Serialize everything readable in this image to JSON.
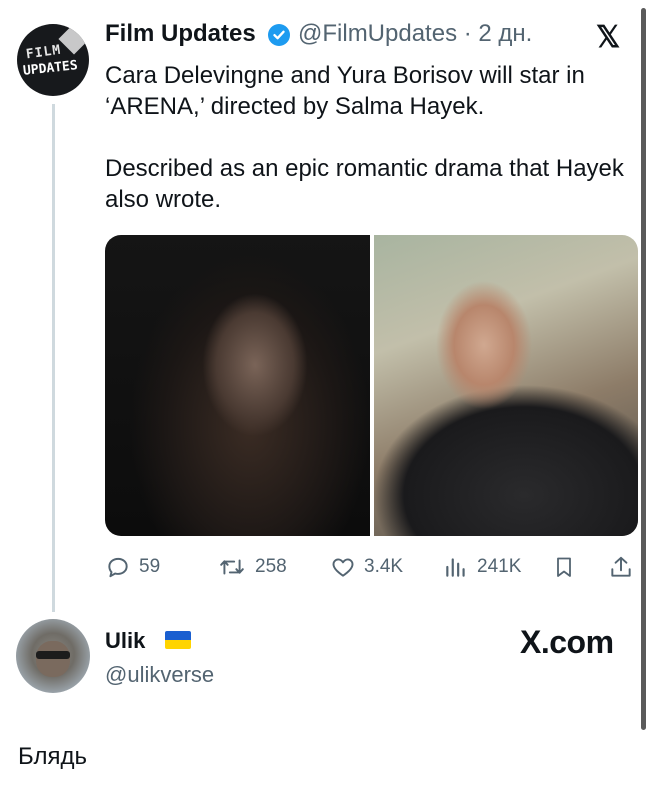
{
  "tweet": {
    "author_name": "Film Updates",
    "handle_time": "@FilmUpdates · 2 дн.",
    "avatar_text_line1": "FILM",
    "avatar_text_line2": "UPDATES",
    "text_para1": "Cara Delevingne and Yura Borisov will star in ‘ARENA,’ directed by Salma Hayek.",
    "text_para2": "Described as an epic romantic drama that Hayek also wrote.",
    "stats": {
      "replies": "59",
      "retweets": "258",
      "likes": "3.4K",
      "views": "241K"
    },
    "icons": [
      "reply-icon",
      "retweet-icon",
      "like-icon",
      "views-icon",
      "bookmark-icon",
      "share-icon",
      "x-logo-icon",
      "verified-badge-icon"
    ]
  },
  "quoter": {
    "name": "Ulik",
    "handle": "@ulikverse",
    "site": "X.com",
    "flag": "ukraine-flag-icon"
  },
  "caption": "Блядь",
  "colors": {
    "text": "#0f1419",
    "secondary": "#536471",
    "verified": "#1d9bf0",
    "thread_line": "#cfd9de"
  }
}
